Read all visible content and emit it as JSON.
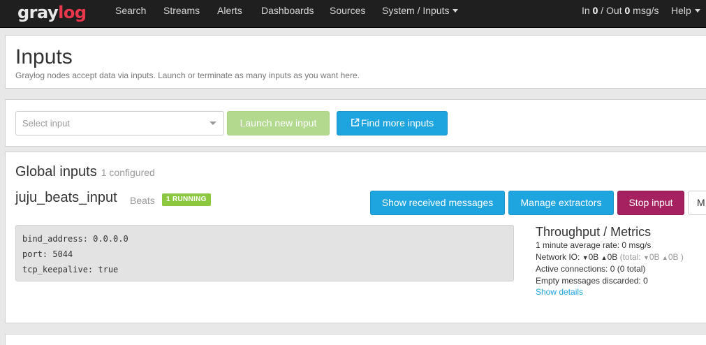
{
  "nav": {
    "logo_main": "gray",
    "logo_accent": "log",
    "links": [
      "Search",
      "Streams",
      "Alerts",
      "Dashboards",
      "Sources",
      "System / Inputs"
    ],
    "throughput_in_label": "In ",
    "throughput_in": "0",
    "throughput_sep": " / Out ",
    "throughput_out": "0",
    "throughput_unit": " msg/s",
    "help": "Help"
  },
  "header": {
    "title": "Inputs",
    "description": "Graylog nodes accept data via inputs. Launch or terminate as many inputs as you want here."
  },
  "launcher": {
    "select_placeholder": "Select input",
    "launch_button": "Launch new input",
    "find_button": "Find more inputs"
  },
  "global_inputs": {
    "title": "Global inputs",
    "count": "1 configured",
    "input": {
      "name": "juju_beats_input",
      "type": "Beats",
      "status": "1 RUNNING",
      "buttons": {
        "show_messages": "Show received messages",
        "manage_extractors": "Manage extractors",
        "stop": "Stop input",
        "more": "M"
      },
      "config": [
        "bind_address: 0.0.0.0",
        "port: 5044",
        "tcp_keepalive: true"
      ],
      "metrics": {
        "title": "Throughput / Metrics",
        "avg_rate": "1 minute average rate: 0 msg/s",
        "network_io_label": "Network IO: ",
        "network_io_down": "0B",
        "network_io_up": "0B",
        "network_total_label": "(total: ",
        "network_total_down": "0B",
        "network_total_up": "0B",
        "network_total_close": " )",
        "active_connections": "Active connections: 0 (0 total)",
        "empty_discarded": "Empty messages discarded: 0",
        "show_details": "Show details"
      }
    }
  },
  "colors": {
    "navbar": "#1f1f1f",
    "brand_accent": "#e8364b",
    "info": "#1ea4de",
    "success_disabled": "#b3d98f",
    "stop": "#a6215f",
    "running_badge": "#8dc63f"
  }
}
